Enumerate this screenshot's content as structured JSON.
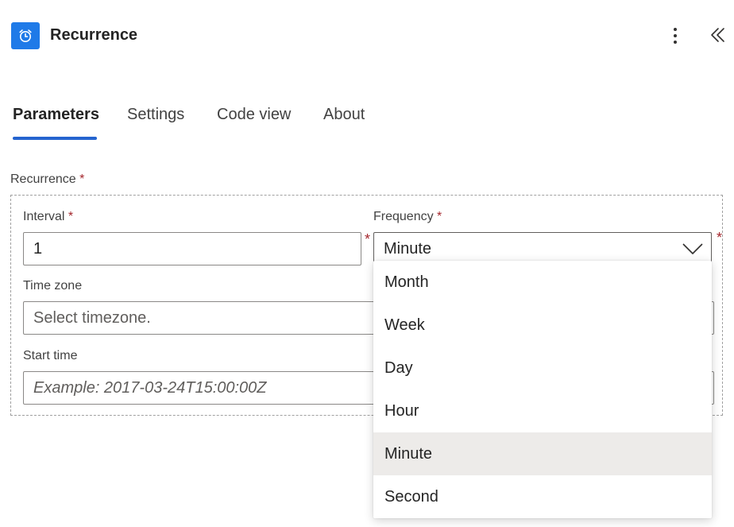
{
  "header": {
    "title": "Recurrence",
    "icon": "alarm-clock-icon",
    "accent_color": "#1f7ae8"
  },
  "tabs": [
    {
      "label": "Parameters",
      "active": true
    },
    {
      "label": "Settings",
      "active": false
    },
    {
      "label": "Code view",
      "active": false
    },
    {
      "label": "About",
      "active": false
    }
  ],
  "form": {
    "group_label": "Recurrence",
    "required_mark": "*",
    "interval": {
      "label": "Interval",
      "value": "1"
    },
    "frequency": {
      "label": "Frequency",
      "value": "Minute"
    },
    "timezone": {
      "label": "Time zone",
      "placeholder": "Select timezone."
    },
    "start_time": {
      "label": "Start time",
      "placeholder": "Example: 2017-03-24T15:00:00Z"
    }
  },
  "frequency_options": [
    "Month",
    "Week",
    "Day",
    "Hour",
    "Minute",
    "Second"
  ],
  "selected_option": "Minute"
}
